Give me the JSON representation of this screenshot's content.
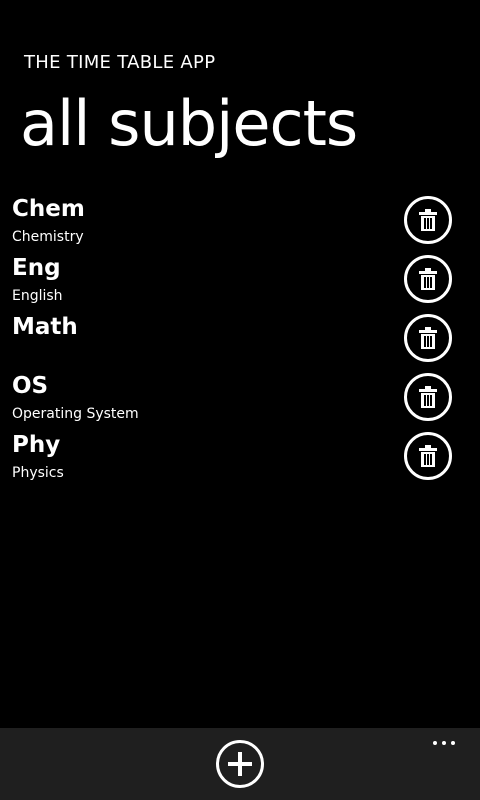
{
  "header": {
    "app_title": "THE TIME TABLE APP",
    "page_title": "all subjects"
  },
  "subjects": [
    {
      "code": "Chem",
      "name": "Chemistry",
      "action_icon": "trash-icon"
    },
    {
      "code": "Eng",
      "name": "English",
      "action_icon": "trash-icon"
    },
    {
      "code": "Math",
      "name": "",
      "action_icon": "trash-icon"
    },
    {
      "code": "OS",
      "name": "Operating System",
      "action_icon": "trash-icon"
    },
    {
      "code": "Phy",
      "name": "Physics",
      "action_icon": "trash-icon"
    }
  ],
  "app_bar": {
    "add_icon": "plus-circle-icon",
    "more_icon": "ellipsis-icon"
  },
  "colors": {
    "background": "#000000",
    "foreground": "#ffffff",
    "app_bar_background": "#1f1f1f"
  }
}
